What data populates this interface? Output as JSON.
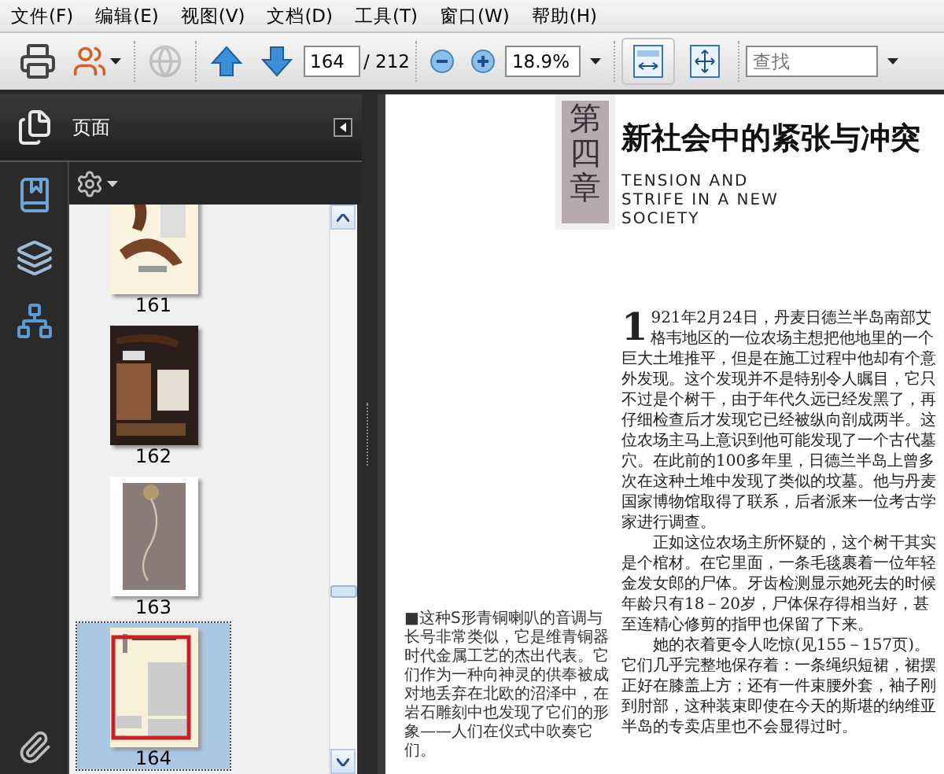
{
  "menu_bar": [
    {
      "label": "文件(F)"
    },
    {
      "label": "编辑(E)"
    },
    {
      "label": "视图(V)"
    },
    {
      "label": "文档(D)"
    },
    {
      "label": "工具(T)"
    },
    {
      "label": "窗口(W)"
    },
    {
      "label": "帮助(H)"
    }
  ],
  "toolbar": {
    "groups": [
      [
        {
          "kind": "print",
          "disabled": false,
          "selected": false
        },
        {
          "kind": "share",
          "disabled": false,
          "selected": false
        }
      ],
      [
        {
          "kind": "review",
          "disabled": true,
          "selected": false
        }
      ],
      [
        {
          "kind": "previous_page",
          "disabled": false,
          "selected": false
        },
        {
          "kind": "next_page",
          "disabled": false,
          "selected": false
        },
        {
          "kind": "page_field",
          "value": "164",
          "total": "/ 212"
        }
      ],
      [
        {
          "kind": "zoom_out",
          "disabled": false,
          "selected": false
        },
        {
          "kind": "zoom_in",
          "disabled": false,
          "selected": false
        },
        {
          "kind": "zoom_field",
          "value": "18.9%"
        }
      ],
      [
        {
          "kind": "fit_width",
          "disabled": false,
          "selected": true
        },
        {
          "kind": "fit_page",
          "disabled": false,
          "selected": false
        }
      ],
      [
        {
          "kind": "search_field",
          "placeholder": "查找"
        }
      ]
    ]
  },
  "sidebar": {
    "title": "页面",
    "rail": [
      {
        "kind": "bookmarks"
      },
      {
        "kind": "layers"
      },
      {
        "kind": "structure"
      },
      {
        "kind": "attachments"
      }
    ],
    "thumbnails": [
      {
        "label": "161",
        "selected": false,
        "kind": "picture"
      },
      {
        "label": "162",
        "selected": false,
        "kind": "picture"
      },
      {
        "label": "163",
        "selected": false,
        "kind": "picture"
      },
      {
        "label": "164",
        "selected": true,
        "kind": "picture"
      }
    ]
  },
  "document": {
    "chapter_mark": "第四章",
    "title": "新社会中的紧张与冲突",
    "subtitle": [
      "TENSION AND",
      "STRIFE IN A NEW",
      "SOCIETY"
    ],
    "caption": "■这种S形青铜喇叭的音调与长号非常类似，它是维青铜器时代金属工艺的杰出代表。它们作为一种向神灵的供奉被成对地丢弃在北欧的沼泽中，在岩石雕刻中也发现了它们的形象——人们在仪式中吹奏它们。",
    "drop_cap": "1",
    "paragraphs": [
      "921年2月24日，丹麦日德兰半岛南部艾格韦地区的一位农场主想把他地里的一个巨大土堆推平，但是在施工过程中他却有个意外发现。这个发现并不是特别令人瞩目，它只不过是个树干，由于年代久远已经发黑了，再仔细检查后才发现它已经被纵向剖成两半。这位农场主马上意识到他可能发现了一个古代墓穴。在此前的100多年里，日德兰半岛上曾多次在这种土堆中发现了类似的坟墓。他与丹麦国家博物馆取得了联系，后者派来一位考古学家进行调查。",
      "正如这位农场主所怀疑的，这个树干其实是个棺材。在它里面，一条毛毯裹着一位年轻金发女郎的尸体。牙齿检测显示她死去的时候年龄只有18－20岁，尸体保存得相当好，甚至连精心修剪的指甲也保留了下来。",
      "她的衣着更令人吃惊(见155－157页)。它们几乎完整地保存着：一条绳织短裙，裙摆正好在膝盖上方；还有一件束腰外套，袖子刚到肘部，这种装束即使在今天的斯堪的纳维亚半岛的专卖店里也不会显得过时。"
    ]
  }
}
